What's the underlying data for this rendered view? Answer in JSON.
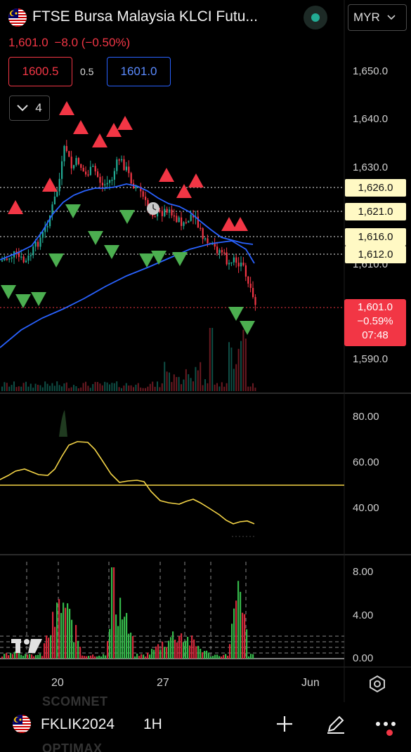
{
  "header": {
    "title": "FTSE Bursa Malaysia KLCI Futu...",
    "currency": "MYR",
    "last_price": "1,601.0",
    "change": "−8.0",
    "change_pct": "(−0.50%)",
    "bid": "1600.5",
    "spread": "0.5",
    "ask": "1601.0",
    "indicators_count": "4"
  },
  "price_axis": {
    "ticks": [
      "1,650.0",
      "1,640.0",
      "1,630.0",
      "1,610.0",
      "1,590.0"
    ],
    "levels": [
      "1,626.0",
      "1,621.0",
      "1,616.0",
      "1,612.0"
    ],
    "current": {
      "price": "1,601.0",
      "change_pct": "−0.59%",
      "countdown": "07:48"
    }
  },
  "oscillator_axis": {
    "ticks": [
      "80.00",
      "60.00",
      "40.00"
    ]
  },
  "histogram_axis": {
    "ticks": [
      "8.00",
      "4.00",
      "0.00"
    ]
  },
  "time_axis": {
    "labels": [
      "20",
      "27",
      "Jun"
    ]
  },
  "bottom_bar": {
    "symbol": "FKLIK2024",
    "timeframe": "1H",
    "ghost_top": "SCOMNET",
    "ghost_bottom": "OPTIMAX"
  },
  "colors": {
    "up": "#22ab94",
    "down": "#f23645",
    "ma_line": "#2962ff",
    "oscillator": "#f5d547",
    "level_label_bg": "#fff9c4"
  },
  "icons": {
    "flag": "malaysia-flag-icon",
    "live": "market-open-dot-icon",
    "collapse": "chevron-down-icon",
    "settings": "gear-icon",
    "add": "plus-icon",
    "draw": "pencil-icon",
    "more": "more-dots-icon",
    "logo": "tradingview-logo-icon"
  }
}
